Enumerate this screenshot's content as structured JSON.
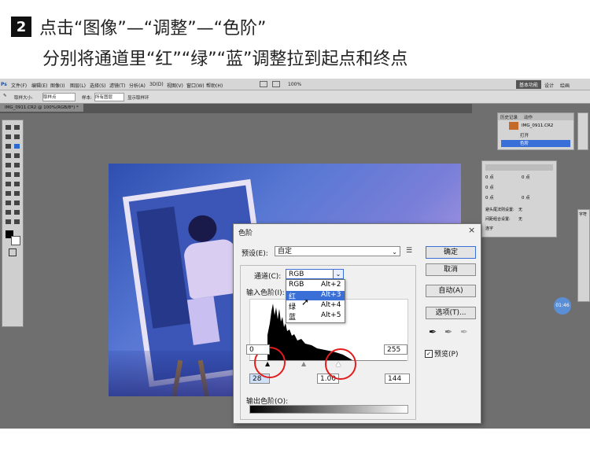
{
  "instruction": {
    "step_number": "2",
    "line1": "点击“图像”—“调整”—“色阶”",
    "line2": "分别将通道里“红”“绿”“蓝”调整拉到起点和终点"
  },
  "photoshop": {
    "logo": "Ps",
    "menu": [
      "文件(F)",
      "编辑(E)",
      "图像(I)",
      "图层(L)",
      "选择(S)",
      "滤镜(T)",
      "分析(A)",
      "3D(D)",
      "视图(V)",
      "窗口(W)",
      "帮助(H)"
    ],
    "workspace_button": "基本功能",
    "workspace_links": [
      "设计",
      "绘画"
    ],
    "options": {
      "sample_size_label": "取样大小:",
      "sample_size_value": "取样点",
      "sample_label": "样本:",
      "sample_value": "所有图层",
      "show_ring": "显示取样环"
    },
    "doc_tab": "IMG_0911.CR2 @ 100%(RGB/8*) *",
    "history_panel": {
      "tabs": [
        "历史记录",
        "动作"
      ],
      "snapshot": "IMG_0911.CR2",
      "items": [
        "打开",
        "色阶"
      ]
    },
    "adjust_rows": [
      "0 点",
      "0 点",
      "0 点",
      "0 点",
      "0 点",
      "0 点"
    ],
    "adjust_labels": {
      "no_space": "避头尾法则设置:",
      "spacing": "间距组合设置:",
      "value": "无",
      "hyphenate": "连字"
    },
    "char_panel_label": "字符",
    "badge": "01:46"
  },
  "levels": {
    "title": "色阶",
    "preset_label": "预设(E):",
    "preset_value": "自定",
    "ok": "确定",
    "cancel": "取消",
    "auto": "自动(A)",
    "options": "选项(T)...",
    "preview": "预览(P)",
    "channel_label": "通道(C):",
    "channel_value": "RGB",
    "input_label": "输入色阶(I):",
    "dropdown": [
      {
        "name": "RGB",
        "shortcut": "Alt+2"
      },
      {
        "name": "红",
        "shortcut": "Alt+3"
      },
      {
        "name": "绿",
        "shortcut": "Alt+4"
      },
      {
        "name": "蓝",
        "shortcut": "Alt+5"
      }
    ],
    "input_black": "28",
    "input_gamma": "1.00",
    "input_white": "144",
    "output_label": "输出色阶(O):",
    "output_black": "0",
    "output_white": "255"
  },
  "colors": {
    "highlight": "#3a6fd8",
    "ring": "#e21c1c",
    "accent_blue": "#5a8fd6"
  }
}
